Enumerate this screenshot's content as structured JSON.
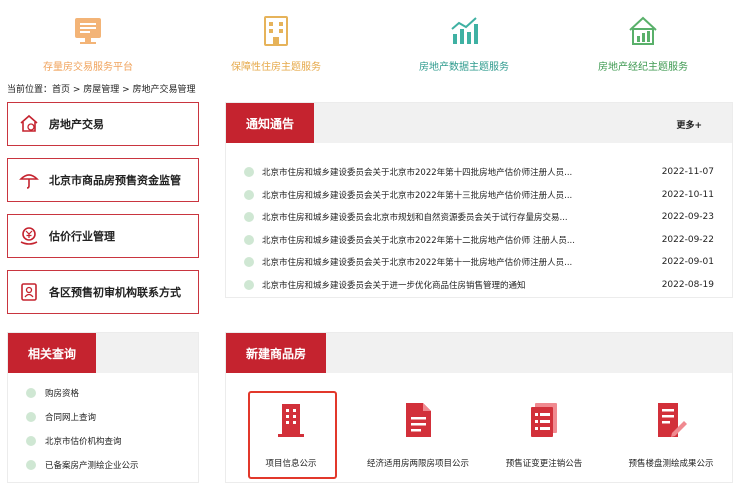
{
  "services": [
    {
      "label": "存量房交易服务平台",
      "icon": "monitor-doc-icon",
      "color": "#f0a35c"
    },
    {
      "label": "保障性住房主题服务",
      "icon": "building-icon",
      "color": "#e6b35a"
    },
    {
      "label": "房地产数据主题服务",
      "icon": "bar-chart-icon",
      "color": "#3fb1a3"
    },
    {
      "label": "房地产经纪主题服务",
      "icon": "house-chart-icon",
      "color": "#59b06a"
    }
  ],
  "breadcrumb": {
    "text": "当前位置：首页 > 房屋管理 > 房地产交易管理"
  },
  "menu": [
    {
      "label": "房地产交易",
      "icon": "house-coin-icon"
    },
    {
      "label": "北京市商品房预售资金监管",
      "icon": "umbrella-icon"
    },
    {
      "label": "估价行业管理",
      "icon": "yuan-hand-icon"
    },
    {
      "label": "各区预售初审机构联系方式",
      "icon": "contact-card-icon"
    }
  ],
  "notice": {
    "title": "通知通告",
    "more": "更多+",
    "items": [
      {
        "text": "北京市住房和城乡建设委员会关于北京市2022年第十四批房地产估价师注册人员...",
        "date": "2022-11-07"
      },
      {
        "text": "北京市住房和城乡建设委员会关于北京市2022年第十三批房地产估价师注册人员...",
        "date": "2022-10-11"
      },
      {
        "text": "北京市住房和城乡建设委员会北京市规划和自然资源委员会关于试行存量房交易...",
        "date": "2022-09-23"
      },
      {
        "text": "北京市住房和城乡建设委员会关于北京市2022年第十二批房地产估价师 注册人员...",
        "date": "2022-09-22"
      },
      {
        "text": "北京市住房和城乡建设委员会关于北京市2022年第十一批房地产估价师注册人员...",
        "date": "2022-09-01"
      },
      {
        "text": "北京市住房和城乡建设委员会关于进一步优化商品住房销售管理的通知",
        "date": "2022-08-19"
      }
    ]
  },
  "related": {
    "title": "相关查询",
    "items": [
      "购房资格",
      "合同网上查询",
      "北京市估价机构查询",
      "已备案房产测绘企业公示"
    ]
  },
  "newhouse": {
    "title": "新建商品房",
    "items": [
      {
        "label": "项目信息公示",
        "icon": "building-doc-icon"
      },
      {
        "label": "经济适用房两限房项目公示",
        "icon": "document-icon"
      },
      {
        "label": "预售证变更注销公告",
        "icon": "list-doc-icon"
      },
      {
        "label": "预售楼盘测绘成果公示",
        "icon": "pen-doc-icon"
      }
    ]
  },
  "colors": {
    "accent": "#c5232f",
    "highlight": "#e2382b"
  }
}
